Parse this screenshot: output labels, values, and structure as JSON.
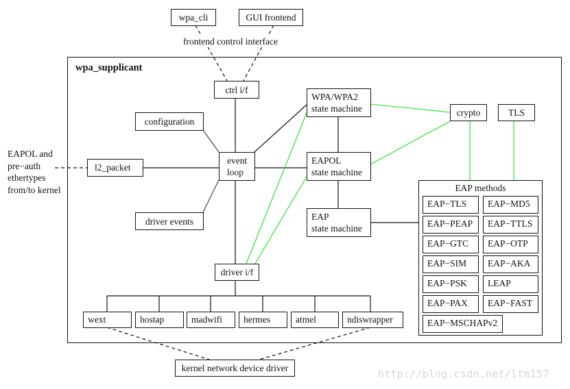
{
  "diagram": {
    "title": "wpa_supplicant",
    "frontends": {
      "wpa_cli": "wpa_cli",
      "gui": "GUI frontend",
      "label": "frontend control interface"
    },
    "external_left": {
      "lines": [
        "EAPOL and",
        "pre−auth",
        "ethertypes",
        "from/to kernel"
      ]
    },
    "components": {
      "ctrl_if": "ctrl i/f",
      "configuration": "configuration",
      "l2_packet": "l2_packet",
      "event_loop": [
        "event",
        "loop"
      ],
      "driver_events": "driver events",
      "driver_if": "driver i/f",
      "wpa_sm": [
        "WPA/WPA2",
        "state machine"
      ],
      "eapol_sm": [
        "EAPOL",
        "state machine"
      ],
      "eap_sm": [
        "EAP",
        "state machine"
      ],
      "crypto": "crypto",
      "tls": "TLS"
    },
    "eap_methods": {
      "title": "EAP methods",
      "items": [
        "EAP−TLS",
        "EAP−MD5",
        "EAP−PEAP",
        "EAP−TTLS",
        "EAP−GTC",
        "EAP−OTP",
        "EAP−SIM",
        "EAP−AKA",
        "EAP−PSK",
        "LEAP",
        "EAP−PAX",
        "EAP−FAST",
        "EAP−MSCHAPv2"
      ]
    },
    "drivers": [
      "wext",
      "hostap",
      "madwifi",
      "hermes",
      "atmel",
      "ndiswrapper"
    ],
    "kernel": "kernel network device driver",
    "colors": {
      "line": "#111111",
      "crypto_link": "#22dd22",
      "watermark": "#d6d6d0"
    }
  },
  "watermark": "http://blog.csdn.net/ltm157"
}
